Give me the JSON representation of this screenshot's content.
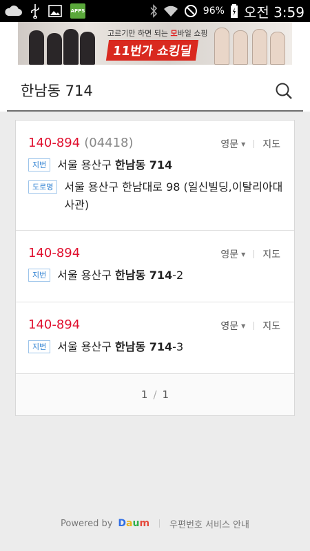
{
  "status_bar": {
    "battery": "96%",
    "time": "오전 3:59",
    "apps_label": "APPS",
    "icons": [
      "cloud-icon",
      "usb-icon",
      "gallery-icon",
      "apps-icon",
      "bluetooth-icon",
      "wifi-icon",
      "do-not-disturb-icon",
      "battery-icon"
    ]
  },
  "banner": {
    "tagline_before": "고르기만 하면 되는 ",
    "tagline_highlight": "모",
    "tagline_after": "바일 쇼핑",
    "title": "11번가 쇼킹딜"
  },
  "search": {
    "query": "한남동 714"
  },
  "results": [
    {
      "zip": "140-894",
      "new_zip": "(04418)",
      "english_label": "영문",
      "map_label": "지도",
      "jibun_label": "지번",
      "jibun_prefix": "서울 용산구 ",
      "jibun_bold": "한남동 714",
      "jibun_suffix": "",
      "road_label": "도로명",
      "road_address": "서울 용산구 한남대로 98 (일신빌딩,이탈리아대사관)"
    },
    {
      "zip": "140-894",
      "english_label": "영문",
      "map_label": "지도",
      "jibun_label": "지번",
      "jibun_prefix": "서울 용산구 ",
      "jibun_bold": "한남동 714",
      "jibun_suffix": "-2"
    },
    {
      "zip": "140-894",
      "english_label": "영문",
      "map_label": "지도",
      "jibun_label": "지번",
      "jibun_prefix": "서울 용산구 ",
      "jibun_bold": "한남동 714",
      "jibun_suffix": "-3"
    }
  ],
  "pagination": {
    "current": "1",
    "total": "1"
  },
  "footer": {
    "powered_by": "Powered by",
    "brand": "Daum",
    "service_link": "우편번호 서비스 안내"
  }
}
